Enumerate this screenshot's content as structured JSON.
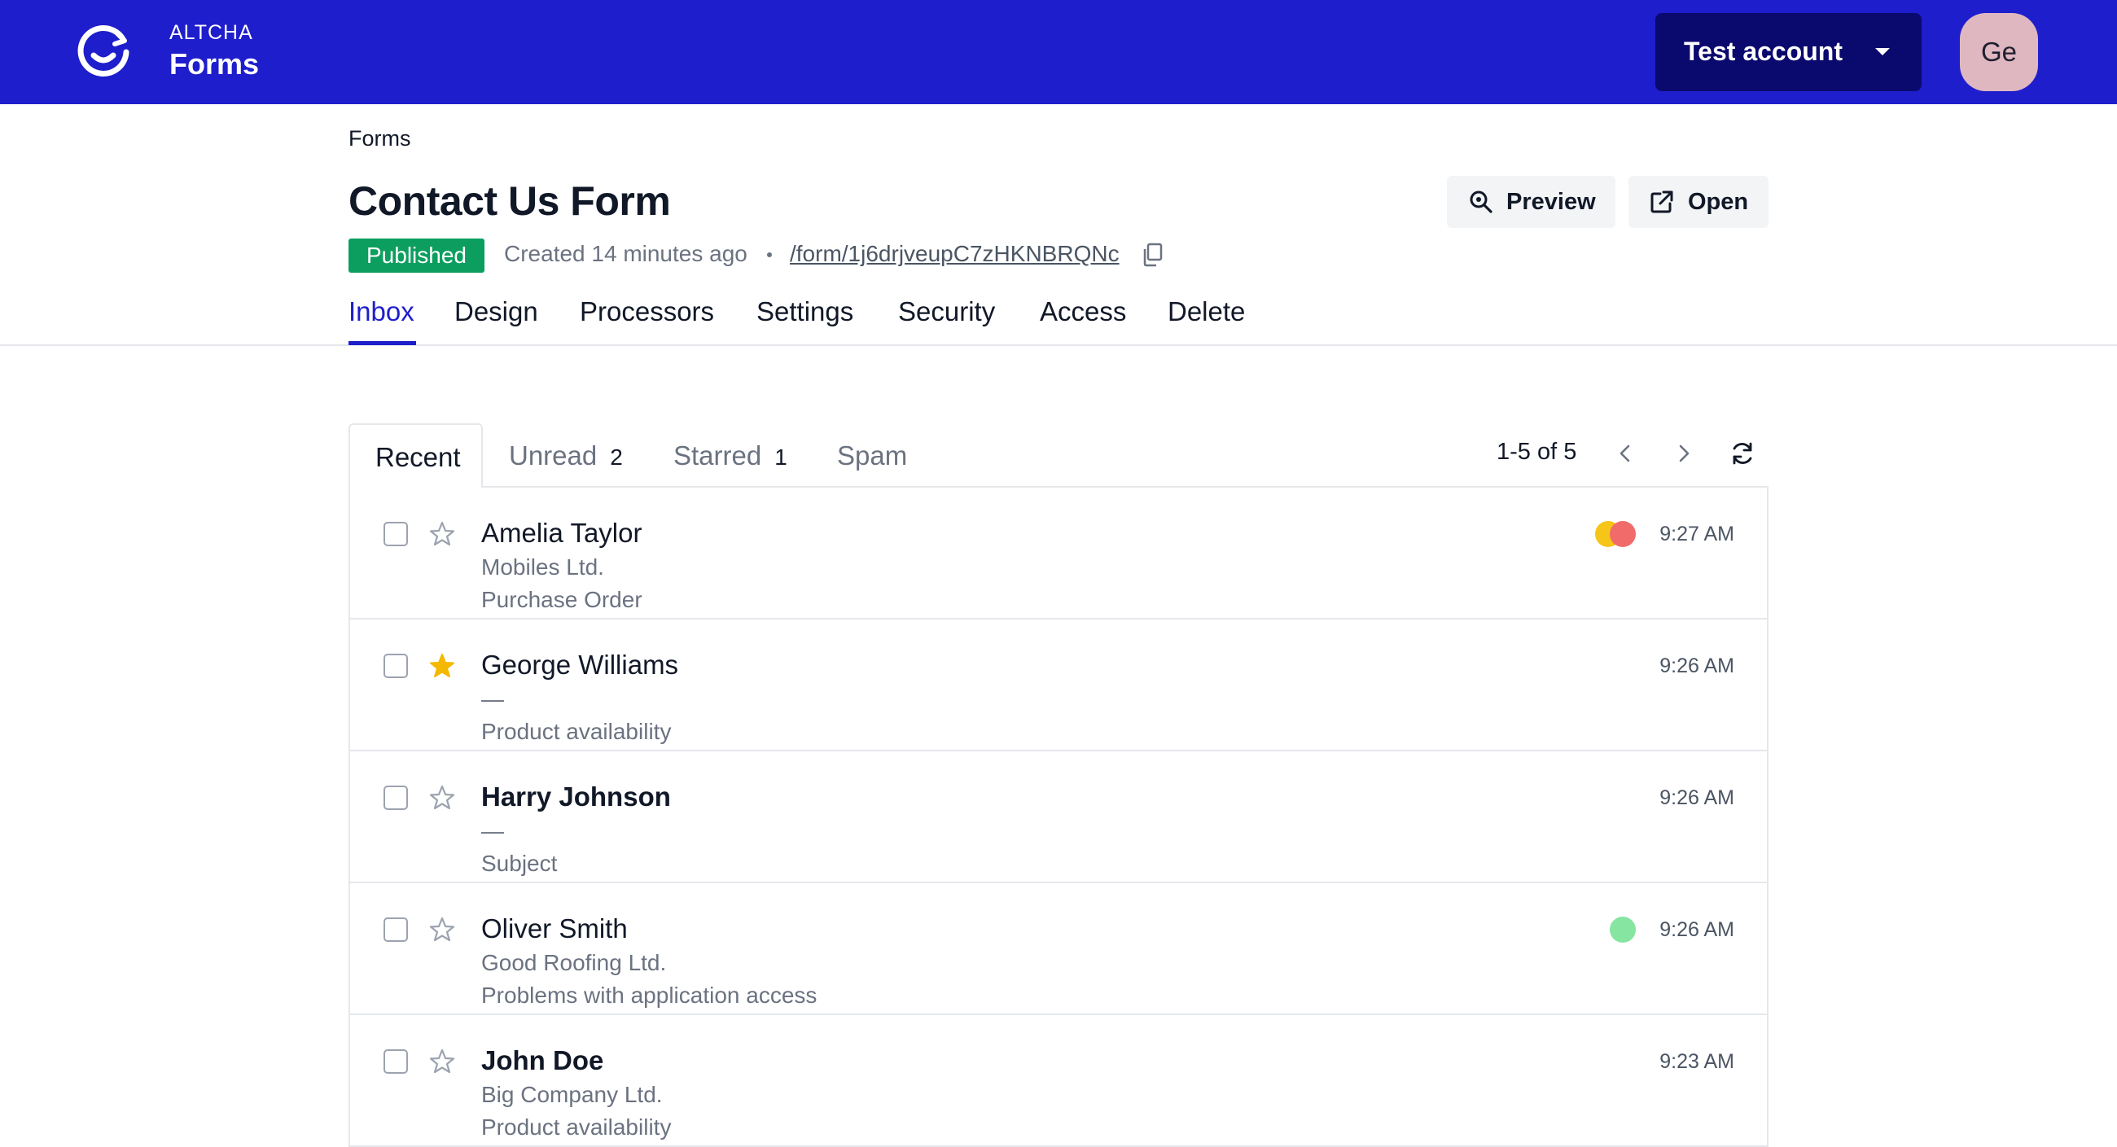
{
  "topbar": {
    "brand_small": "ALTCHA",
    "brand_big": "Forms",
    "account_label": "Test account",
    "avatar_initials": "Ge",
    "bg_color": "#1e1ecc"
  },
  "header": {
    "breadcrumb": "Forms",
    "title": "Contact Us Form",
    "status": "Published",
    "created": "Created 14 minutes ago",
    "form_path": "/form/1j6drjveupC7zHKNBRQNc",
    "preview_label": "Preview",
    "open_label": "Open"
  },
  "nav_tabs": [
    "Inbox",
    "Design",
    "Processors",
    "Settings",
    "Security",
    "Access",
    "Delete"
  ],
  "inbox": {
    "tabs": {
      "recent": "Recent",
      "unread": "Unread",
      "unread_count": "2",
      "starred": "Starred",
      "starred_count": "1",
      "spam": "Spam"
    },
    "pager_text": "1-5 of 5",
    "rows": [
      {
        "name": "Amelia Taylor",
        "company": "Mobiles Ltd.",
        "subject": "Purchase Order",
        "time": "9:27 AM",
        "starred": false,
        "unread": false,
        "tags": [
          "#f5c518",
          "#f26b6b"
        ]
      },
      {
        "name": "George Williams",
        "company": "—",
        "subject": "Product availability",
        "time": "9:26 AM",
        "starred": true,
        "unread": false,
        "tags": []
      },
      {
        "name": "Harry Johnson",
        "company": "—",
        "subject": "Subject",
        "time": "9:26 AM",
        "starred": false,
        "unread": true,
        "tags": []
      },
      {
        "name": "Oliver Smith",
        "company": "Good Roofing Ltd.",
        "subject": "Problems with application access",
        "time": "9:26 AM",
        "starred": false,
        "unread": false,
        "tags": [
          "#86e5a0"
        ]
      },
      {
        "name": "John Doe",
        "company": "Big Company Ltd.",
        "subject": "Product availability",
        "time": "9:23 AM",
        "starred": false,
        "unread": true,
        "tags": []
      }
    ]
  },
  "colors": {
    "accent": "#1e1ecc",
    "published": "#0c9e5f",
    "star_filled": "#f5b800"
  }
}
